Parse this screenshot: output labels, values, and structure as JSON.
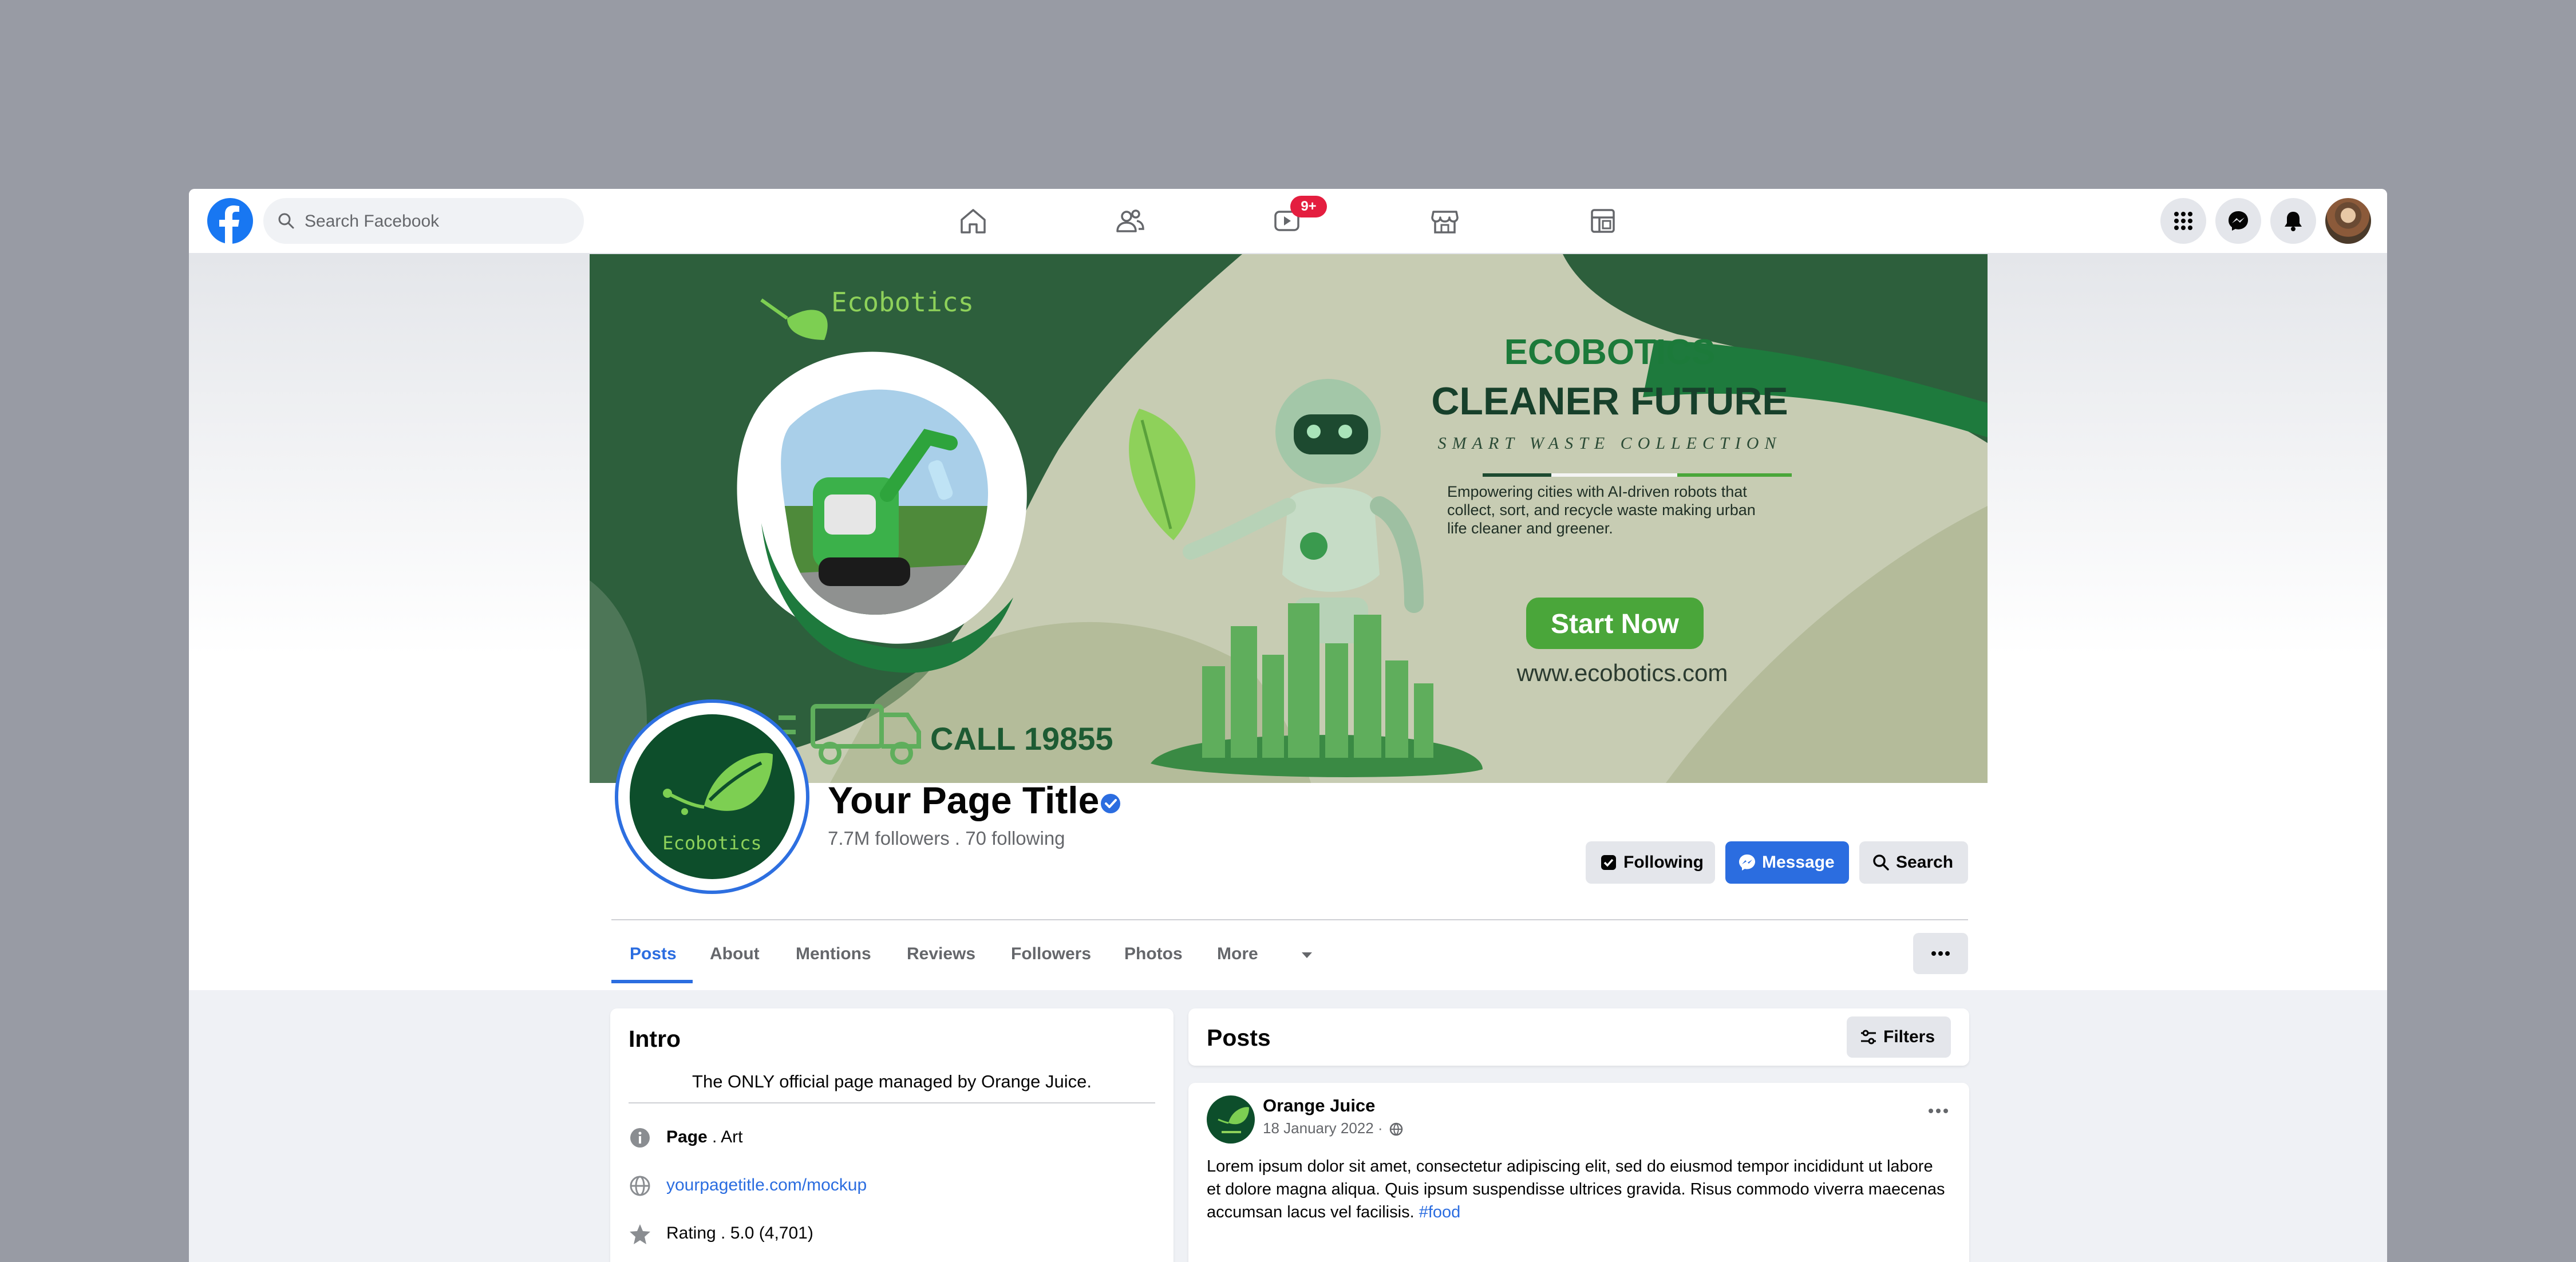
{
  "topnav": {
    "search_placeholder": "Search Facebook",
    "video_badge": "9+",
    "icons": [
      "facebook-logo",
      "home-icon",
      "friends-icon",
      "video-icon",
      "marketplace-icon",
      "groups-icon",
      "menu-grid-icon",
      "messenger-icon",
      "notifications-icon"
    ]
  },
  "cover": {
    "brand": "Ecobotics",
    "headline_1": "ECOBOTICS",
    "headline_2": "CLEANER FUTURE",
    "tagline": "SMART WASTE COLLECTION",
    "blurb_lines": [
      "Empowering cities with AI-driven robots that",
      "collect, sort, and recycle waste making urban",
      "life cleaner and greener."
    ],
    "cta": "Start Now",
    "website": "www.ecobotics.com",
    "call": "CALL 19855"
  },
  "profile": {
    "name_on_logo": "Ecobotics",
    "title": "Your Page Title",
    "followers_line": "7.7M followers . 70 following"
  },
  "actions": {
    "following": "Following",
    "message": "Message",
    "search": "Search"
  },
  "tabs": [
    {
      "label": "Posts",
      "active": true
    },
    {
      "label": "About"
    },
    {
      "label": "Mentions"
    },
    {
      "label": "Reviews"
    },
    {
      "label": "Followers"
    },
    {
      "label": "Photos"
    },
    {
      "label": "More"
    }
  ],
  "intro": {
    "heading": "Intro",
    "description": "The ONLY official page managed by Orange Juice.",
    "page_label": "Page",
    "page_category": " . Art",
    "website": "yourpagetitle.com/mockup",
    "rating": "Rating . 5.0 (4,701)"
  },
  "posts": {
    "heading": "Posts",
    "filters": "Filters",
    "items": [
      {
        "author": "Orange Juice",
        "date": "18 January 2022 · ",
        "text": "Lorem ipsum dolor sit amet, consectetur adipiscing elit, sed do eiusmod tempor incididunt ut labore et dolore magna aliqua. Quis ipsum suspendisse ultrices gravida. Risus commodo viverra maecenas accumsan lacus vel facilisis. ",
        "hashtag": "#food"
      }
    ]
  },
  "colors": {
    "accent": "#2b6de0",
    "brand_green": "#0d4e2b",
    "cta_green": "#4aa63a",
    "badge_red": "#e41e3f"
  }
}
